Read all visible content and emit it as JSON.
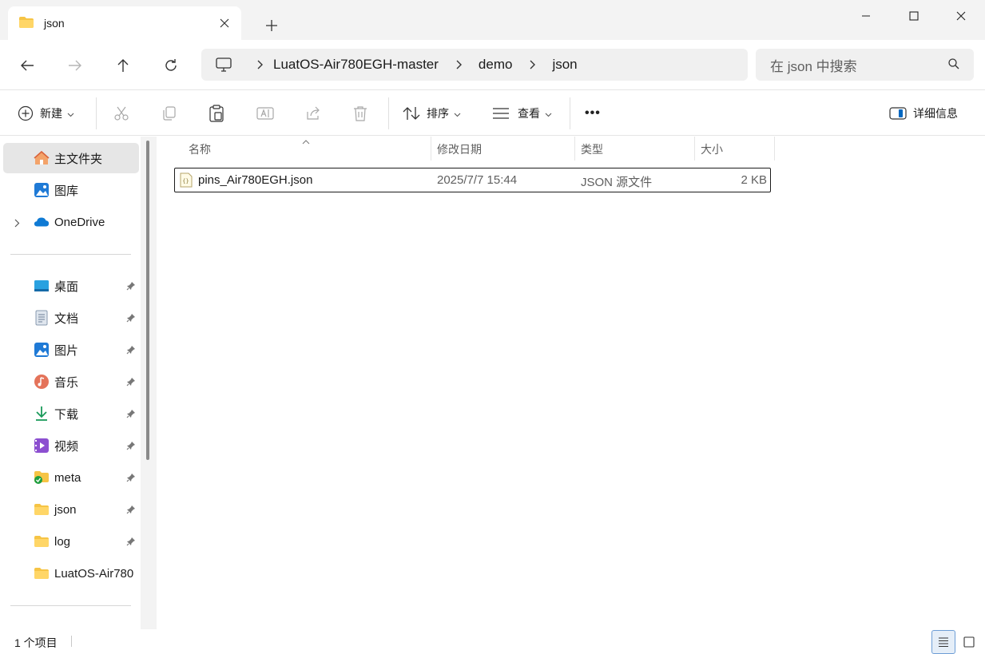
{
  "tab": {
    "title": "json"
  },
  "address": {
    "segments": [
      "LuatOS-Air780EGH-master",
      "demo",
      "json"
    ],
    "search_placeholder": "在 json 中搜索"
  },
  "toolbar": {
    "new_label": "新建",
    "sort_label": "排序",
    "view_label": "查看",
    "more_label": "•••",
    "details_label": "详细信息"
  },
  "sidebar": {
    "home": "主文件夹",
    "gallery": "图库",
    "onedrive": "OneDrive",
    "quick": [
      {
        "label": "桌面",
        "icon": "desktop-icon"
      },
      {
        "label": "文档",
        "icon": "document-icon"
      },
      {
        "label": "图片",
        "icon": "pictures-icon"
      },
      {
        "label": "音乐",
        "icon": "music-icon"
      },
      {
        "label": "下载",
        "icon": "download-icon"
      },
      {
        "label": "视频",
        "icon": "video-icon"
      },
      {
        "label": "meta",
        "icon": "folder-synced-icon"
      },
      {
        "label": "json",
        "icon": "folder-icon"
      },
      {
        "label": "log",
        "icon": "folder-icon"
      },
      {
        "label": "LuatOS-Air780",
        "icon": "folder-icon"
      }
    ]
  },
  "columns": {
    "name": "名称",
    "date": "修改日期",
    "type": "类型",
    "size": "大小"
  },
  "files": [
    {
      "name": "pins_Air780EGH.json",
      "date": "2025/7/7 15:44",
      "type": "JSON 源文件",
      "size": "2 KB"
    }
  ],
  "status": {
    "count": "1 个项目"
  },
  "colors": {
    "folder": "#f6c445",
    "accent": "#0067c0",
    "selection": "#e6e6e6"
  }
}
